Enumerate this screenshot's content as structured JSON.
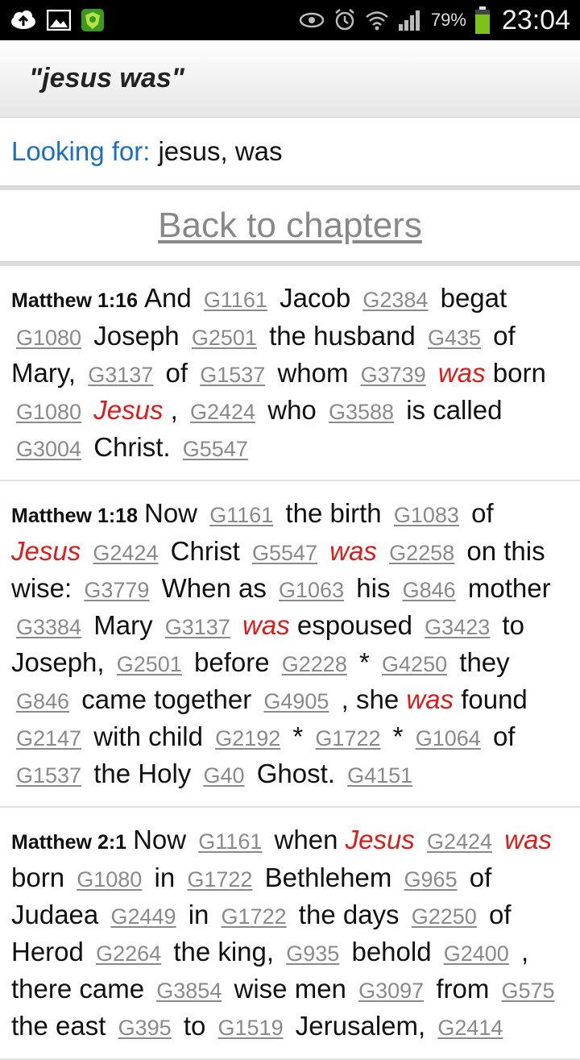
{
  "status_bar": {
    "left_icons": [
      "cloud-upload-icon",
      "image-icon",
      "shield-app-icon"
    ],
    "right_icons": [
      "eye-icon",
      "alarm-icon",
      "wifi-icon",
      "signal-icon"
    ],
    "battery_percent": "79%",
    "time": "23:04",
    "battery_color": "#7cc21b"
  },
  "header": {
    "title": "\"jesus was\""
  },
  "search": {
    "label": "Looking for:",
    "value": "jesus, was"
  },
  "nav": {
    "back_label": "Back to chapters"
  },
  "colors": {
    "highlight": "#e01919",
    "label_blue": "#1a6fc4",
    "strong_link": "#8a8a8a"
  },
  "verses": [
    {
      "ref": "Matthew 1:16",
      "tokens": [
        {
          "t": "w",
          "v": "And"
        },
        {
          "t": "s",
          "v": "G1161"
        },
        {
          "t": "w",
          "v": "Jacob"
        },
        {
          "t": "s",
          "v": "G2384"
        },
        {
          "t": "w",
          "v": "begat"
        },
        {
          "t": "s",
          "v": "G1080"
        },
        {
          "t": "w",
          "v": "Joseph"
        },
        {
          "t": "s",
          "v": "G2501"
        },
        {
          "t": "w",
          "v": "the husband"
        },
        {
          "t": "s",
          "v": "G435"
        },
        {
          "t": "w",
          "v": "of Mary,"
        },
        {
          "t": "s",
          "v": "G3137"
        },
        {
          "t": "w",
          "v": "of"
        },
        {
          "t": "s",
          "v": "G1537"
        },
        {
          "t": "w",
          "v": "whom"
        },
        {
          "t": "s",
          "v": "G3739"
        },
        {
          "t": "h",
          "v": "was"
        },
        {
          "t": "w",
          "v": "born"
        },
        {
          "t": "s",
          "v": "G1080"
        },
        {
          "t": "h",
          "v": "Jesus"
        },
        {
          "t": "w",
          "v": ","
        },
        {
          "t": "s",
          "v": "G2424"
        },
        {
          "t": "w",
          "v": "who"
        },
        {
          "t": "s",
          "v": "G3588"
        },
        {
          "t": "w",
          "v": "is called"
        },
        {
          "t": "s",
          "v": "G3004"
        },
        {
          "t": "w",
          "v": "Christ."
        },
        {
          "t": "s",
          "v": "G5547"
        }
      ]
    },
    {
      "ref": "Matthew 1:18",
      "tokens": [
        {
          "t": "w",
          "v": "Now"
        },
        {
          "t": "s",
          "v": "G1161"
        },
        {
          "t": "w",
          "v": "the birth"
        },
        {
          "t": "s",
          "v": "G1083"
        },
        {
          "t": "w",
          "v": "of"
        },
        {
          "t": "h",
          "v": "Jesus"
        },
        {
          "t": "s",
          "v": "G2424"
        },
        {
          "t": "w",
          "v": "Christ"
        },
        {
          "t": "s",
          "v": "G5547"
        },
        {
          "t": "h",
          "v": "was"
        },
        {
          "t": "s",
          "v": "G2258"
        },
        {
          "t": "w",
          "v": "on this wise:"
        },
        {
          "t": "s",
          "v": "G3779"
        },
        {
          "t": "w",
          "v": "When as"
        },
        {
          "t": "s",
          "v": "G1063"
        },
        {
          "t": "w",
          "v": "his"
        },
        {
          "t": "s",
          "v": "G846"
        },
        {
          "t": "w",
          "v": "mother"
        },
        {
          "t": "s",
          "v": "G3384"
        },
        {
          "t": "w",
          "v": "Mary"
        },
        {
          "t": "s",
          "v": "G3137"
        },
        {
          "t": "h",
          "v": "was"
        },
        {
          "t": "w",
          "v": "espoused"
        },
        {
          "t": "s",
          "v": "G3423"
        },
        {
          "t": "w",
          "v": "to Joseph,"
        },
        {
          "t": "s",
          "v": "G2501"
        },
        {
          "t": "w",
          "v": "before"
        },
        {
          "t": "s",
          "v": "G2228"
        },
        {
          "t": "w",
          "v": "*"
        },
        {
          "t": "s",
          "v": "G4250"
        },
        {
          "t": "w",
          "v": "they"
        },
        {
          "t": "s",
          "v": "G846"
        },
        {
          "t": "w",
          "v": "came together"
        },
        {
          "t": "s",
          "v": "G4905"
        },
        {
          "t": "w",
          "v": ", she"
        },
        {
          "t": "h",
          "v": "was"
        },
        {
          "t": "w",
          "v": "found"
        },
        {
          "t": "s",
          "v": "G2147"
        },
        {
          "t": "w",
          "v": "with child"
        },
        {
          "t": "s",
          "v": "G2192"
        },
        {
          "t": "w",
          "v": "*"
        },
        {
          "t": "s",
          "v": "G1722"
        },
        {
          "t": "w",
          "v": "*"
        },
        {
          "t": "s",
          "v": "G1064"
        },
        {
          "t": "w",
          "v": "of"
        },
        {
          "t": "s",
          "v": "G1537"
        },
        {
          "t": "w",
          "v": "the Holy"
        },
        {
          "t": "s",
          "v": "G40"
        },
        {
          "t": "w",
          "v": "Ghost."
        },
        {
          "t": "s",
          "v": "G4151"
        }
      ]
    },
    {
      "ref": "Matthew 2:1",
      "tokens": [
        {
          "t": "w",
          "v": "Now"
        },
        {
          "t": "s",
          "v": "G1161"
        },
        {
          "t": "w",
          "v": "when"
        },
        {
          "t": "h",
          "v": "Jesus"
        },
        {
          "t": "s",
          "v": "G2424"
        },
        {
          "t": "h",
          "v": "was"
        },
        {
          "t": "w",
          "v": "born"
        },
        {
          "t": "s",
          "v": "G1080"
        },
        {
          "t": "w",
          "v": "in"
        },
        {
          "t": "s",
          "v": "G1722"
        },
        {
          "t": "w",
          "v": "Bethlehem"
        },
        {
          "t": "s",
          "v": "G965"
        },
        {
          "t": "w",
          "v": "of Judaea"
        },
        {
          "t": "s",
          "v": "G2449"
        },
        {
          "t": "w",
          "v": "in"
        },
        {
          "t": "s",
          "v": "G1722"
        },
        {
          "t": "w",
          "v": "the days"
        },
        {
          "t": "s",
          "v": "G2250"
        },
        {
          "t": "w",
          "v": "of Herod"
        },
        {
          "t": "s",
          "v": "G2264"
        },
        {
          "t": "w",
          "v": "the king,"
        },
        {
          "t": "s",
          "v": "G935"
        },
        {
          "t": "w",
          "v": "behold"
        },
        {
          "t": "s",
          "v": "G2400"
        },
        {
          "t": "w",
          "v": ", there came"
        },
        {
          "t": "s",
          "v": "G3854"
        },
        {
          "t": "w",
          "v": "wise men"
        },
        {
          "t": "s",
          "v": "G3097"
        },
        {
          "t": "w",
          "v": "from"
        },
        {
          "t": "s",
          "v": "G575"
        },
        {
          "t": "w",
          "v": "the east"
        },
        {
          "t": "s",
          "v": "G395"
        },
        {
          "t": "w",
          "v": "to"
        },
        {
          "t": "s",
          "v": "G1519"
        },
        {
          "t": "w",
          "v": "Jerusalem,"
        },
        {
          "t": "s",
          "v": "G2414"
        }
      ]
    }
  ]
}
